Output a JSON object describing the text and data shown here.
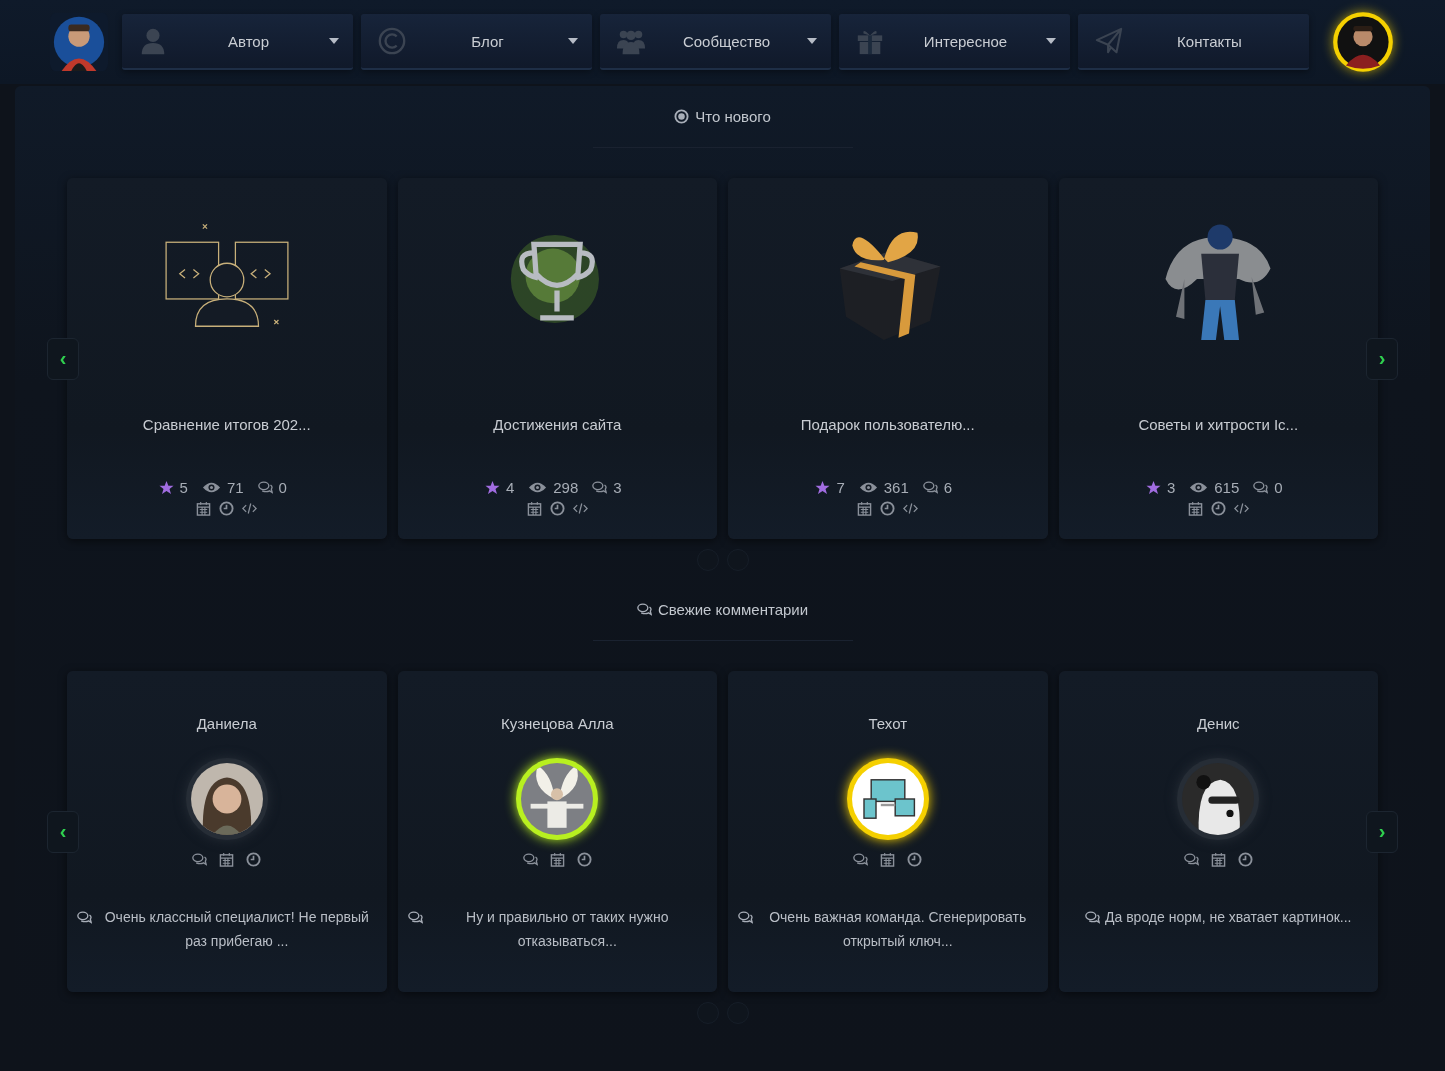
{
  "nav": [
    {
      "label": "Автор",
      "dropdown": true
    },
    {
      "label": "Блог",
      "dropdown": true
    },
    {
      "label": "Сообщество",
      "dropdown": true
    },
    {
      "label": "Интересное",
      "dropdown": true
    },
    {
      "label": "Контакты",
      "dropdown": false
    }
  ],
  "news": {
    "title": "Что нового",
    "prev": "‹",
    "next": "›",
    "posts": [
      {
        "title": "Сравнение итогов 202...",
        "stars": "5",
        "views": "71",
        "comments": "0"
      },
      {
        "title": "Достижения сайта",
        "stars": "4",
        "views": "298",
        "comments": "3"
      },
      {
        "title": "Подарок пользователю...",
        "stars": "7",
        "views": "361",
        "comments": "6"
      },
      {
        "title": "Советы и хитрости Ic...",
        "stars": "3",
        "views": "615",
        "comments": "0"
      }
    ]
  },
  "comments": {
    "title": "Свежие комментарии",
    "prev": "‹",
    "next": "›",
    "items": [
      {
        "author": "Даниела",
        "color": "#262d36",
        "text": "Очень классный специалист! Не первый раз прибегаю ..."
      },
      {
        "author": "Кузнецова Алла",
        "color": "#b8f020",
        "text": "Ну и правильно от таких нужно отказываться..."
      },
      {
        "author": "Техот",
        "color": "#f5d000",
        "text": "Очень важная команда. Сгенерировать открытый ключ..."
      },
      {
        "author": "Денис",
        "color": "#262d36",
        "text": "Да вроде норм, не хватает картинок..."
      }
    ]
  }
}
